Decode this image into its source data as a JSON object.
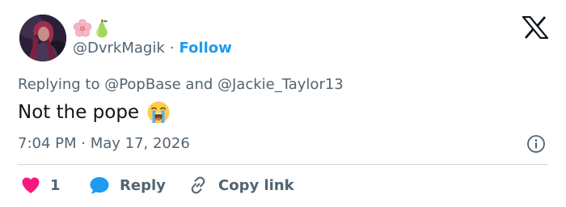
{
  "author": {
    "name_emojis": [
      "cherry-blossom-icon",
      "pear-icon"
    ],
    "handle": "@DvrkMagik",
    "separator": "·",
    "follow_label": "Follow"
  },
  "reply_context": {
    "prefix": "Replying to ",
    "mention_1": "@PopBase",
    "conjunction": " and ",
    "mention_2": "@Jackie_Taylor13"
  },
  "tweet": {
    "text": "Not the pope",
    "emoji": "loudly-crying-face-icon",
    "timestamp": "7:04 PM · May 17, 2026"
  },
  "actions": {
    "like_count": "1",
    "reply_label": "Reply",
    "copy_link_label": "Copy link"
  },
  "colors": {
    "accent": "#1d9bf0",
    "like": "#f91880",
    "muted_text": "#536471",
    "text": "#0f1419",
    "divider": "#cfd9de"
  }
}
